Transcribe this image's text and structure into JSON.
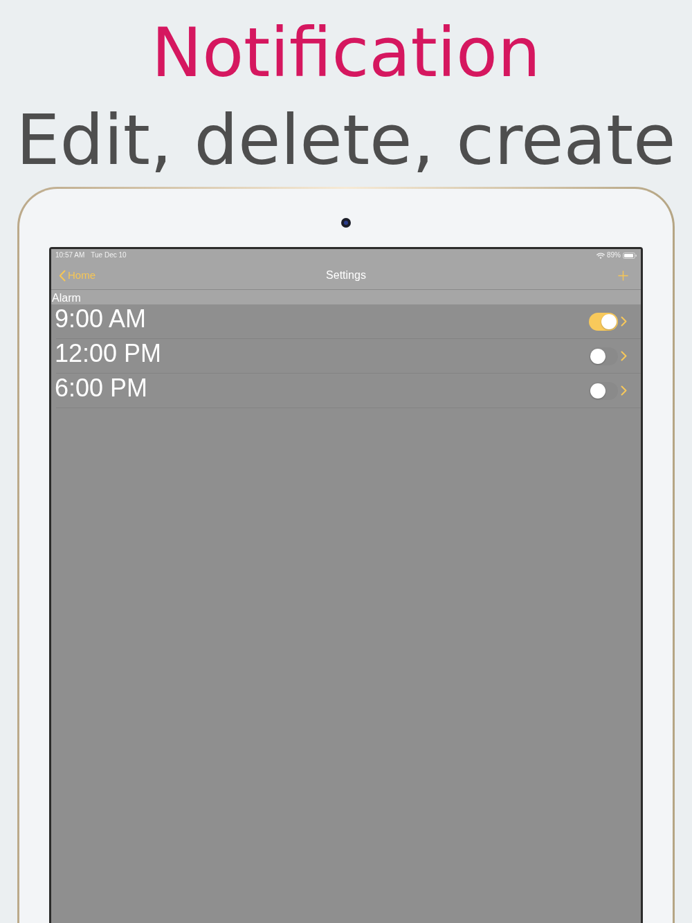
{
  "header": {
    "title": "Notification",
    "subtitle": "Edit, delete, create"
  },
  "status_bar": {
    "time": "10:57 AM",
    "date": "Tue Dec 10",
    "battery": "89%"
  },
  "nav_bar": {
    "back": "Home",
    "title": "Settings"
  },
  "section": {
    "header": "Alarm",
    "rows": [
      {
        "time": "9:00 AM",
        "on": true
      },
      {
        "time": "12:00 PM",
        "on": false
      },
      {
        "time": "6:00 PM",
        "on": false
      }
    ]
  }
}
